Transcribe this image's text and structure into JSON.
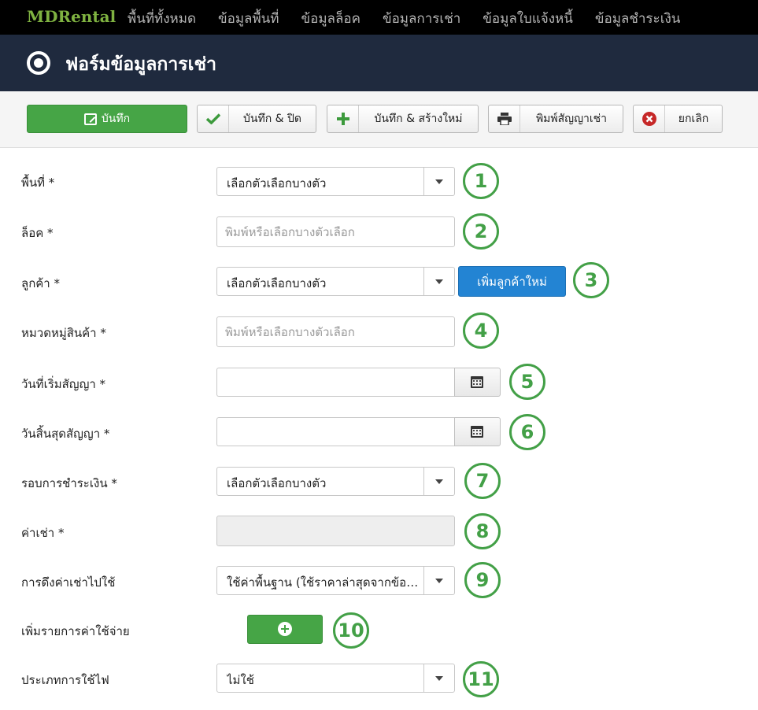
{
  "nav": {
    "brand": "MDRental",
    "items": [
      "พื้นที่ทั้งหมด",
      "ข้อมูลพื้นที่",
      "ข้อมูลล็อค",
      "ข้อมูลการเช่า",
      "ข้อมูลใบแจ้งหนี้",
      "ข้อมูลชำระเงิน"
    ]
  },
  "page": {
    "title": "ฟอร์มข้อมูลการเช่า"
  },
  "toolbar": {
    "save": "บันทึก",
    "save_close": "บันทึก & ปิด",
    "save_new": "บันทึก & สร้างใหม่",
    "print_contract": "พิมพ์สัญญาเช่า",
    "cancel": "ยกเลิก"
  },
  "form": {
    "area": {
      "label": "พื้นที่ *",
      "value": "เลือกตัวเลือกบางตัว",
      "badge": "1"
    },
    "lock": {
      "label": "ล็อค *",
      "placeholder": "พิมพ์หรือเลือกบางตัวเลือก",
      "badge": "2"
    },
    "customer": {
      "label": "ลูกค้า *",
      "value": "เลือกตัวเลือกบางตัว",
      "add_button": "เพิ่มลูกค้าใหม่",
      "badge": "3"
    },
    "category": {
      "label": "หมวดหมู่สินค้า *",
      "placeholder": "พิมพ์หรือเลือกบางตัวเลือก",
      "badge": "4"
    },
    "start_date": {
      "label": "วันที่เริ่มสัญญา *",
      "badge": "5"
    },
    "end_date": {
      "label": "วันสิ้นสุดสัญญา *",
      "badge": "6"
    },
    "billing_cycle": {
      "label": "รอบการชำระเงิน *",
      "value": "เลือกตัวเลือกบางตัว",
      "badge": "7"
    },
    "rent": {
      "label": "ค่าเช่า *",
      "badge": "8"
    },
    "rent_source": {
      "label": "การดึงค่าเช่าไปใช้",
      "value": "ใช้ค่าพื้นฐาน (ใช้ราคาล่าสุดจากข้อมูลล็อค)",
      "badge": "9"
    },
    "add_expense": {
      "label": "เพิ่มรายการค่าใช้จ่าย",
      "badge": "10"
    },
    "electricity": {
      "label": "ประเภทการใช้ไฟ",
      "value": "ไม่ใช้",
      "badge": "11"
    }
  },
  "colors": {
    "accent_green": "#46a546",
    "badge_green": "#43a047",
    "button_blue": "#2384d3",
    "title_bar": "#1f2a3e",
    "nav_bg": "#000000"
  }
}
